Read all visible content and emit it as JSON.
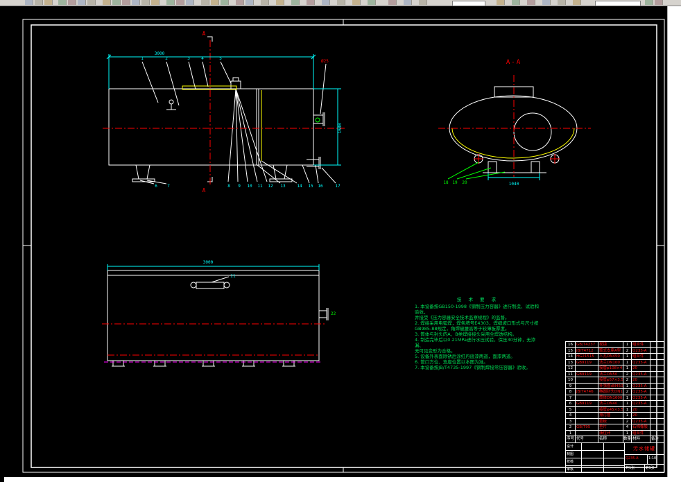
{
  "drawing": {
    "front_view": {
      "section_label": "A",
      "dim_length": "3000",
      "dim_height": "1600",
      "red_tag": "Ø25",
      "balloons_top": [
        "1",
        "2",
        "3",
        "4",
        "5"
      ],
      "balloons_bottom": [
        "6",
        "7",
        "8",
        "9",
        "10",
        "11",
        "12",
        "13",
        "14",
        "15",
        "16",
        "17"
      ]
    },
    "section_view": {
      "label": "A-A",
      "dim_width": "1040",
      "balloons": [
        "18",
        "19",
        "20"
      ]
    },
    "plan_view": {
      "dim_length": "3000",
      "balloon_top": "21",
      "balloon_right": "22"
    },
    "notes": {
      "title": "技 术 要 求",
      "lines": [
        "1. 本设备按GB150-1998《钢制压力容器》进行制造、试验和验收，",
        "并接受《压力容器安全技术监察规程》的监督。",
        "2. 焊接采用电弧焊，焊条牌号E4303，焊缝坡口形式与尺寸按",
        "GB985-88规定，角焊缝腰高等于较薄板厚度。",
        "3. 筒体与封头的A、B类焊接接头采用全焊透结构。",
        "4. 制造完毕后以0.21MPa进行水压试验，保压30分钟，无渗漏、",
        "无可见变形为合格。",
        "5. 设备外表面除锈后涂红丹底漆两道，面漆两道。",
        "6. 管口方位、支座位置以本图为准。",
        "7. 本设备按JB/T4735-1997《钢制焊接常压容器》验收。"
      ]
    },
    "parts_table": {
      "headers": [
        "序号",
        "代号",
        "名称",
        "数量",
        "材料",
        "备注"
      ],
      "rows": [
        {
          "seq": "16",
          "code": "GB/T4237",
          "name": "视镜",
          "qty": "1",
          "mat": "组合件",
          "rem": ""
        },
        {
          "seq": "15",
          "code": "JB/T4712",
          "name": "鞍式支座A型",
          "qty": "2",
          "mat": "Q235-A",
          "rem": ""
        },
        {
          "seq": "14",
          "code": "HG21515",
          "name": "人孔DN450",
          "qty": "1",
          "mat": "组合件",
          "rem": ""
        },
        {
          "seq": "13",
          "code": "GB9119",
          "name": "法兰DN100",
          "qty": "1",
          "mat": "Q235-A",
          "rem": ""
        },
        {
          "seq": "12",
          "code": "",
          "name": "接管φ108×4",
          "qty": "1",
          "mat": "20",
          "rem": ""
        },
        {
          "seq": "11",
          "code": "GB9119",
          "name": "法兰DN50",
          "qty": "2",
          "mat": "Q235-A",
          "rem": ""
        },
        {
          "seq": "10",
          "code": "",
          "name": "接管φ57×3.5",
          "qty": "2",
          "mat": "20",
          "rem": ""
        },
        {
          "seq": "9",
          "code": "",
          "name": "补强圈dN450",
          "qty": "1",
          "mat": "Q235-A",
          "rem": ""
        },
        {
          "seq": "8",
          "code": "JB/T4746",
          "name": "椭圆封头DN1600",
          "qty": "2",
          "mat": "Q235-A",
          "rem": ""
        },
        {
          "seq": "7",
          "code": "",
          "name": "筒体DN1600",
          "qty": "1",
          "mat": "Q235-A",
          "rem": ""
        },
        {
          "seq": "6",
          "code": "GB9119",
          "name": "法兰DN40",
          "qty": "1",
          "mat": "Q235-A",
          "rem": ""
        },
        {
          "seq": "5",
          "code": "",
          "name": "接管φ45×3.5",
          "qty": "1",
          "mat": "20",
          "rem": ""
        },
        {
          "seq": "4",
          "code": "",
          "name": "排污管",
          "qty": "1",
          "mat": "20",
          "rem": ""
        },
        {
          "seq": "3",
          "code": "",
          "name": "垫板",
          "qty": "2",
          "mat": "Q235-A",
          "rem": ""
        },
        {
          "seq": "2",
          "code": "GB/T95",
          "name": "垫片",
          "qty": "4",
          "mat": "石棉橡胶",
          "rem": ""
        },
        {
          "seq": "1",
          "code": "",
          "name": "液位计",
          "qty": "1",
          "mat": "组合件",
          "rem": ""
        }
      ]
    },
    "title_block": {
      "title": "污水储罐",
      "material": "Q235-A",
      "scale": "1:10",
      "sheet_total": "共1张",
      "sheet_no": "第1张",
      "sign_labels": [
        "设计",
        "制图",
        "校核",
        "审核"
      ]
    }
  }
}
